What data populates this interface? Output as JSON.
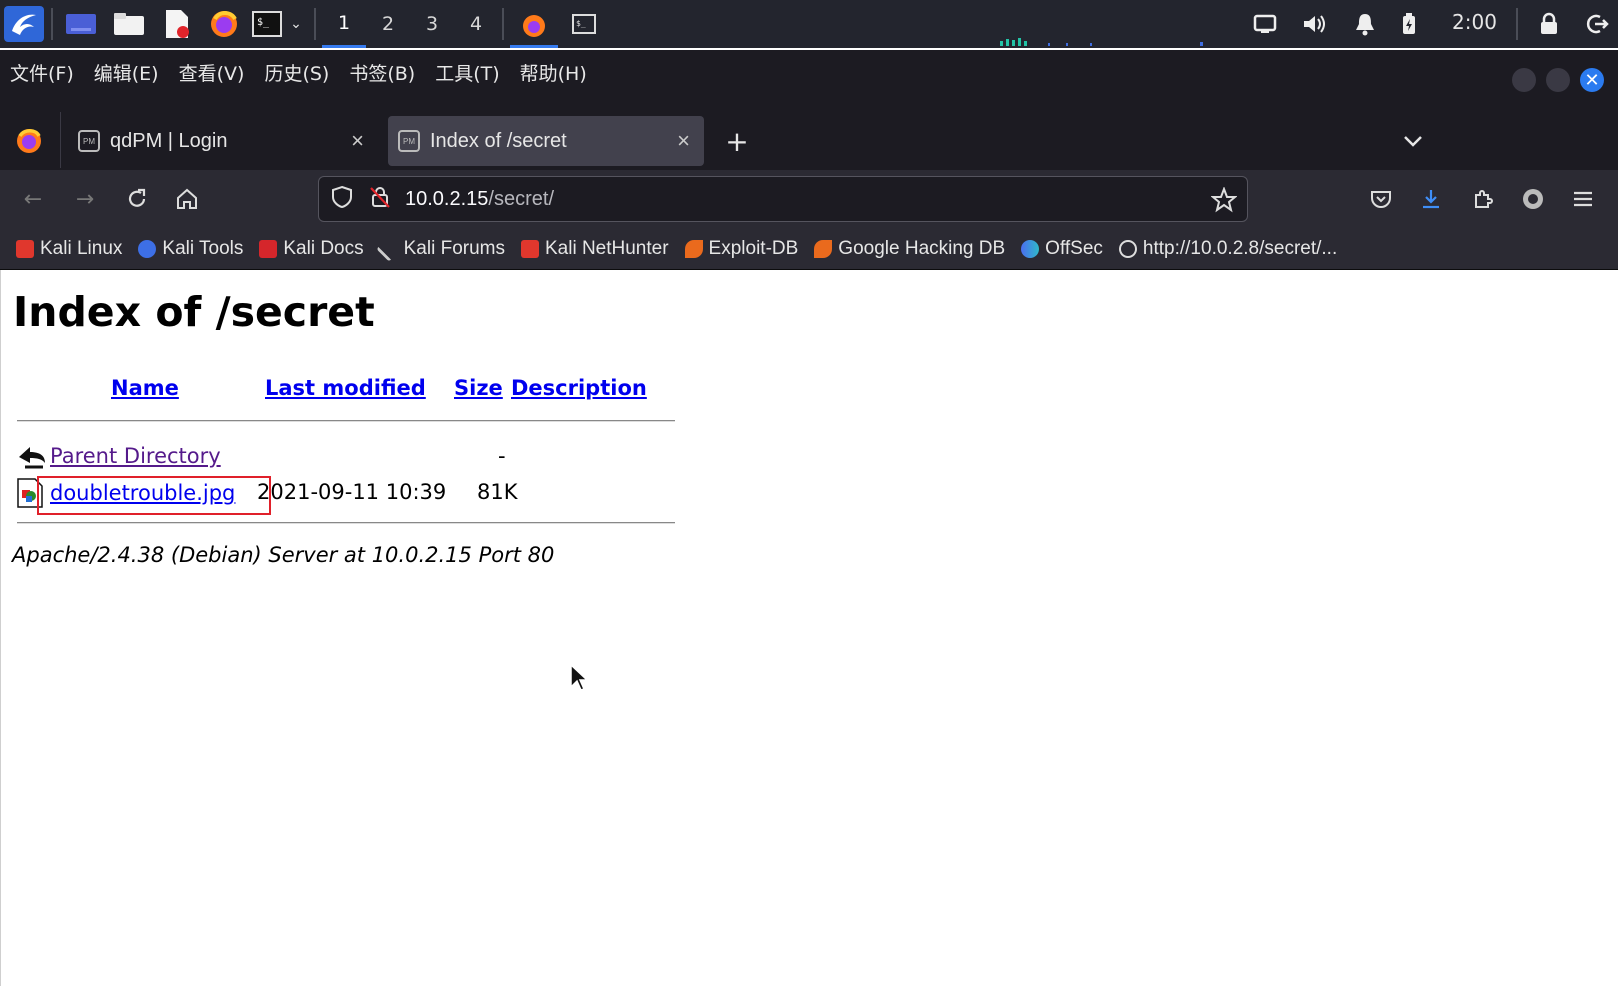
{
  "taskbar": {
    "workspaces": [
      "1",
      "2",
      "3",
      "4"
    ],
    "active_workspace": "1",
    "clock": "2:00"
  },
  "menubar": {
    "items": [
      "文件(F)",
      "编辑(E)",
      "查看(V)",
      "历史(S)",
      "书签(B)",
      "工具(T)",
      "帮助(H)"
    ]
  },
  "tabs": [
    {
      "title": "qdPM | Login",
      "favicon": "PM",
      "active": false
    },
    {
      "title": "Index of /secret",
      "favicon": "PM",
      "active": true
    }
  ],
  "urlbar": {
    "host": "10.0.2.15",
    "path": "/secret/"
  },
  "bookmarks": [
    {
      "label": "Kali Linux",
      "icon": "kali-dragon-icon",
      "color": "#e0372d"
    },
    {
      "label": "Kali Tools",
      "icon": "kali-tools-icon",
      "color": "#3d6fe6"
    },
    {
      "label": "Kali Docs",
      "icon": "kali-docs-icon",
      "color": "#d5262b"
    },
    {
      "label": "Kali Forums",
      "icon": "kali-forums-icon",
      "color": "#cccccc"
    },
    {
      "label": "Kali NetHunter",
      "icon": "nethunter-icon",
      "color": "#e0372d"
    },
    {
      "label": "Exploit-DB",
      "icon": "exploitdb-icon",
      "color": "#ea6a1d"
    },
    {
      "label": "Google Hacking DB",
      "icon": "ghdb-icon",
      "color": "#ea6a1d"
    },
    {
      "label": "OffSec",
      "icon": "offsec-icon",
      "color": "#4b6ef0"
    },
    {
      "label": "http://10.0.2.8/secret/...",
      "icon": "globe-icon",
      "color": "#dddddd"
    }
  ],
  "page": {
    "title": "Index of /secret",
    "columns": {
      "name": "Name",
      "modified": "Last modified",
      "size": "Size",
      "description": "Description"
    },
    "rows": [
      {
        "name": "Parent Directory",
        "modified": "",
        "size": "-",
        "description": "",
        "icon": "back-arrow-icon",
        "visited": true
      },
      {
        "name": "doubletrouble.jpg",
        "modified": "2021-09-11 10:39",
        "size": "81K",
        "description": "",
        "icon": "image-file-icon",
        "visited": false
      }
    ],
    "footer": "Apache/2.4.38 (Debian) Server at 10.0.2.15 Port 80"
  },
  "colors": {
    "link": "#0000ee",
    "visited": "#551a8b",
    "highlight": "#e0202a",
    "accent": "#367bf0"
  }
}
